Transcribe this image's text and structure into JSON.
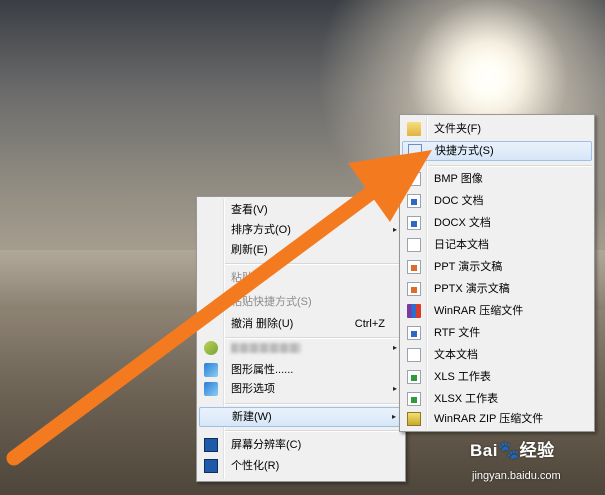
{
  "context_menu": {
    "items": [
      {
        "label": "查看(V)",
        "arrow": "▸"
      },
      {
        "label": "排序方式(O)",
        "arrow": "▸"
      },
      {
        "label": "刷新(E)"
      },
      {
        "label": "粘贴",
        "disabled": true
      },
      {
        "label": "粘贴快捷方式(S)",
        "disabled": true
      },
      {
        "label": "撤消 删除(U)",
        "shortcut": "Ctrl+Z"
      },
      {
        "label": "",
        "blurred": true,
        "arrow": "▸"
      },
      {
        "label": "图形属性......"
      },
      {
        "label": "图形选项",
        "arrow": "▸"
      },
      {
        "label": "新建(W)",
        "arrow": "▸",
        "highlighted": true
      },
      {
        "label": "屏幕分辨率(C)"
      },
      {
        "label": "个性化(R)"
      }
    ]
  },
  "new_submenu": {
    "items": [
      {
        "label": "文件夹(F)",
        "icon": "folder-icon"
      },
      {
        "label": "快捷方式(S)",
        "icon": "shortcut-icon",
        "highlighted": true
      },
      {
        "label": "BMP 图像",
        "icon": "bmp-icon"
      },
      {
        "label": "DOC 文档",
        "icon": "doc-icon"
      },
      {
        "label": "DOCX 文档",
        "icon": "docx-icon"
      },
      {
        "label": "日记本文档",
        "icon": "journal-icon"
      },
      {
        "label": "PPT 演示文稿",
        "icon": "ppt-icon"
      },
      {
        "label": "PPTX 演示文稿",
        "icon": "pptx-icon"
      },
      {
        "label": "WinRAR 压缩文件",
        "icon": "winrar-icon"
      },
      {
        "label": "RTF 文件",
        "icon": "rtf-icon"
      },
      {
        "label": "文本文档",
        "icon": "txt-icon"
      },
      {
        "label": "XLS 工作表",
        "icon": "xls-icon"
      },
      {
        "label": "XLSX 工作表",
        "icon": "xlsx-icon"
      },
      {
        "label": "WinRAR ZIP 压缩文件",
        "icon": "zip-icon"
      }
    ]
  },
  "watermark": {
    "logo": "Bai🐾经验",
    "url": "jingyan.baidu.com"
  },
  "colors": {
    "arrow": "#f47a20",
    "highlight_border": "#9cc0e6",
    "menu_bg": "#f0f0f0"
  }
}
